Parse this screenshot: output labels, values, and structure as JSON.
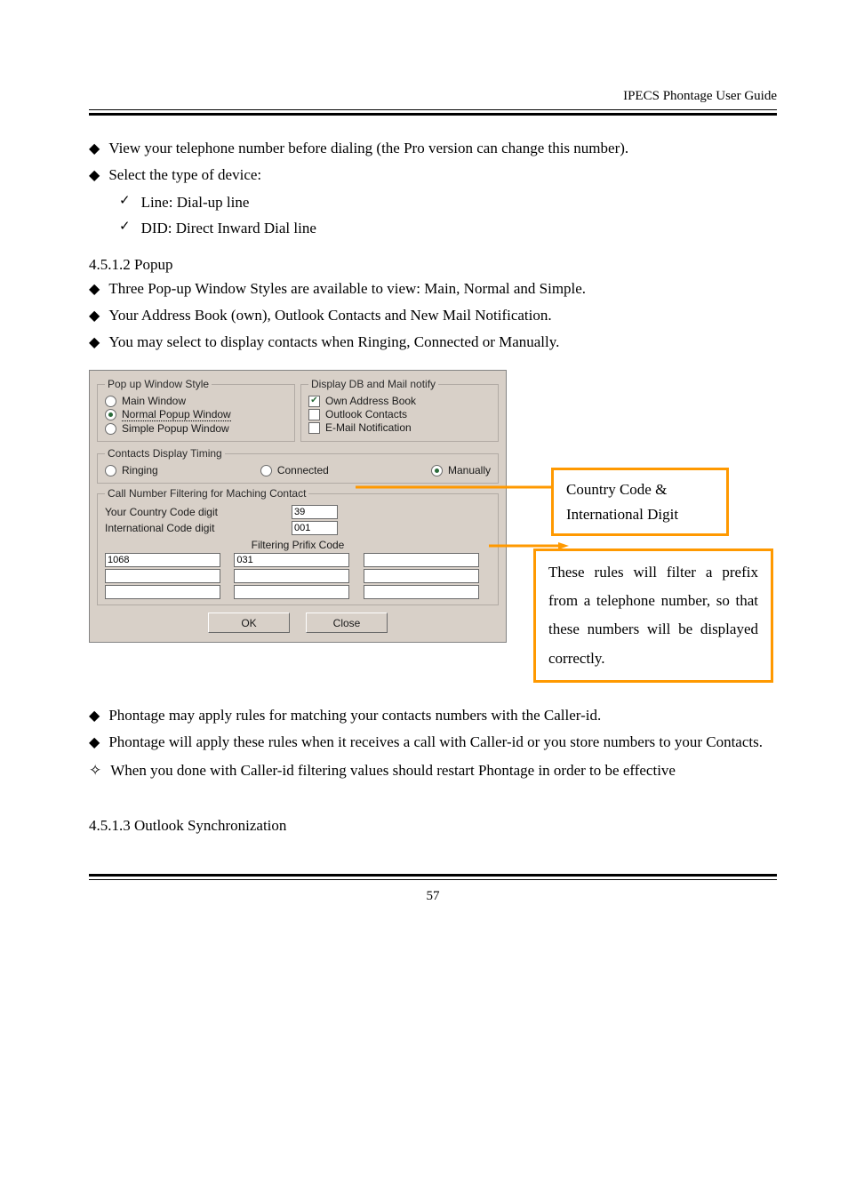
{
  "header": {
    "title": "IPECS Phontage User Guide"
  },
  "footer": {
    "page": "57"
  },
  "sections": {
    "s1": {
      "i0": "View your telephone number before dialing (the Pro version can change this number).",
      "i1": "Select the type of device:",
      "chk": [
        "Line: Dial-up line",
        "DID: Direct Inward Dial line"
      ]
    },
    "sub_heading1": "4.5.1.2 Popup",
    "s2": {
      "i0": "Three Pop-up Window Styles are available to view: Main, Normal and Simple.",
      "i1": "Your Address Book (own), Outlook Contacts and New Mail Notification.",
      "i2": "You may select to display contacts when Ringing, Connected or Manually."
    },
    "s3": {
      "i0": "Phontage may apply rules for matching your contacts numbers with the Caller-id.",
      "i1": "Phontage will apply these rules when it receives a call with Caller-id or you store numbers to your Contacts."
    },
    "sub_heading2": "4.5.1.3 Outlook Synchronization",
    "note": "When you done with Caller-id filtering values should restart Phontage in order to be effective"
  },
  "dialog": {
    "groups": {
      "popup_style": {
        "legend": "Pop up Window Style",
        "options": [
          "Main Window",
          "Normal Popup Window",
          "Simple Popup Window"
        ],
        "selected_index": 1
      },
      "db_mail": {
        "legend": "Display DB and Mail notify",
        "options": [
          "Own Address Book",
          "Outlook Contacts",
          "E-Mail Notification"
        ],
        "checked": [
          true,
          false,
          false
        ]
      },
      "timing": {
        "legend": "Contacts Display Timing",
        "options": [
          "Ringing",
          "Connected",
          "Manually"
        ],
        "selected_index": 2
      },
      "filtering": {
        "legend": "Call Number Filtering for Maching Contact",
        "country_label": "Your Country Code digit",
        "country_value": "39",
        "intl_label": "International Code digit",
        "intl_value": "001",
        "prefix_title": "Filtering Prifix Code",
        "prefix": [
          "1068",
          "031",
          "",
          "",
          "",
          "",
          "",
          "",
          ""
        ]
      }
    },
    "buttons": {
      "ok": "OK",
      "close": "Close"
    }
  },
  "callouts": {
    "c1_l1": "Country Code &",
    "c1_l2": "International Digit",
    "c2": "These rules will filter a prefix from a telephone number, so that these numbers will be displayed correctly."
  }
}
